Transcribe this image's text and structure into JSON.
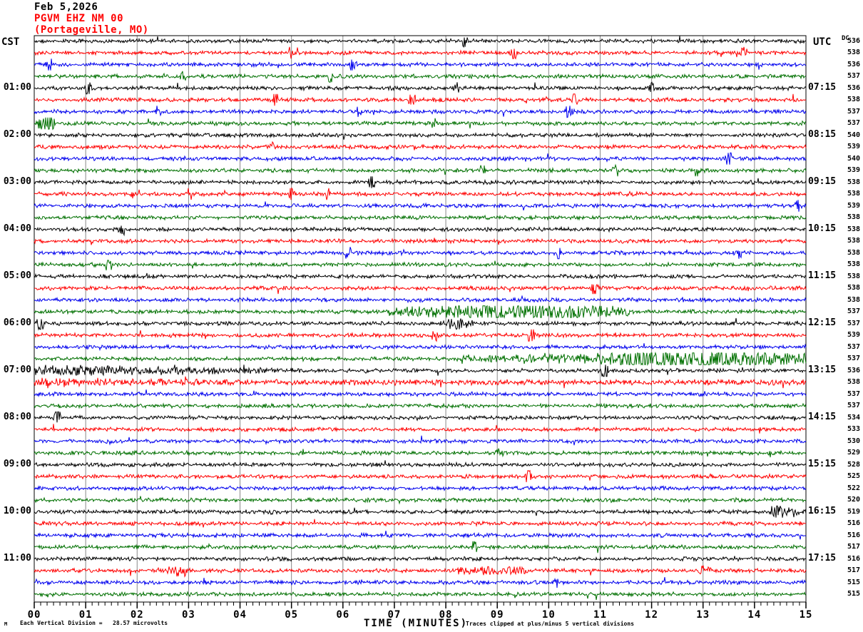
{
  "header": {
    "date": "Feb 5,2026",
    "station": "PGVM EHZ NM 00",
    "location": "(Portageville, MO)"
  },
  "corners": {
    "left_tz": "CST",
    "right_tz": "UTC",
    "dc_header": "DC"
  },
  "footer": {
    "mark": "M",
    "scale_note": "Each Vertical Division =   28.57 microvolts",
    "clip_note": "Traces clipped at plus/minus 5 vertical divisions"
  },
  "colors": {
    "trace_cycle": [
      "#000000",
      "#ff0000",
      "#0000ee",
      "#007000"
    ],
    "grid": "#888888",
    "frame": "#000000",
    "header_accent": "#ff0000"
  },
  "chart_data": {
    "type": "line",
    "subtype": "helicorder-seismogram",
    "title": "PGVM EHZ NM 00 (Portageville, MO) Feb 5,2026",
    "station": "PGVM EHZ NM 00",
    "location": "Portageville, MO",
    "date": "Feb 5,2026",
    "x_label": "TIME (MINUTES)",
    "x_range_minutes": [
      0,
      15
    ],
    "num_traces": 48,
    "trace_duration_minutes": 15,
    "first_trace_start_cst": "00:00",
    "left_timezone": "CST",
    "right_timezone": "UTC",
    "scale": "Each Vertical Division = 28.57 microvolts",
    "clipping": "Traces clipped at plus/minus 5 vertical divisions",
    "x_tick_labels": [
      "00",
      "01",
      "02",
      "03",
      "04",
      "05",
      "06",
      "07",
      "08",
      "09",
      "10",
      "11",
      "12",
      "13",
      "14",
      "15"
    ],
    "left_time_labels_cst": [
      {
        "row": 4,
        "text": "01:00"
      },
      {
        "row": 8,
        "text": "02:00"
      },
      {
        "row": 12,
        "text": "03:00"
      },
      {
        "row": 16,
        "text": "04:00"
      },
      {
        "row": 20,
        "text": "05:00"
      },
      {
        "row": 24,
        "text": "06:00"
      },
      {
        "row": 28,
        "text": "07:00"
      },
      {
        "row": 32,
        "text": "08:00"
      },
      {
        "row": 36,
        "text": "09:00"
      },
      {
        "row": 40,
        "text": "10:00"
      },
      {
        "row": 44,
        "text": "11:00"
      }
    ],
    "right_time_labels_utc": [
      {
        "row": 4,
        "text": "07:15"
      },
      {
        "row": 8,
        "text": "08:15"
      },
      {
        "row": 12,
        "text": "09:15"
      },
      {
        "row": 16,
        "text": "10:15"
      },
      {
        "row": 20,
        "text": "11:15"
      },
      {
        "row": 24,
        "text": "12:15"
      },
      {
        "row": 28,
        "text": "13:15"
      },
      {
        "row": 32,
        "text": "14:15"
      },
      {
        "row": 36,
        "text": "15:15"
      },
      {
        "row": 40,
        "text": "16:15"
      },
      {
        "row": 44,
        "text": "17:15"
      }
    ],
    "dc_offsets": [
      536,
      538,
      536,
      537,
      536,
      538,
      537,
      537,
      540,
      539,
      540,
      539,
      538,
      538,
      539,
      538,
      538,
      538,
      538,
      538,
      538,
      538,
      538,
      537,
      537,
      539,
      537,
      537,
      536,
      538,
      537,
      537,
      534,
      533,
      530,
      529,
      528,
      525,
      522,
      520,
      519,
      516,
      516,
      517,
      516,
      517,
      515,
      515
    ],
    "events": [
      {
        "row": 0,
        "kind": "spike",
        "t0": 8.35,
        "amp": 5
      },
      {
        "row": 1,
        "kind": "spike",
        "t0": 5.0,
        "amp": 4
      },
      {
        "row": 1,
        "kind": "spike",
        "t0": 9.3,
        "amp": 4.5
      },
      {
        "row": 1,
        "kind": "spike",
        "t0": 13.8,
        "amp": 4
      },
      {
        "row": 2,
        "kind": "spike",
        "t0": 0.3,
        "amp": 5
      },
      {
        "row": 2,
        "kind": "spike",
        "t0": 6.2,
        "amp": 3.5
      },
      {
        "row": 3,
        "kind": "spike",
        "t0": 2.9,
        "amp": 3
      },
      {
        "row": 3,
        "kind": "spike",
        "t0": 5.75,
        "amp": 4.5
      },
      {
        "row": 4,
        "kind": "spike",
        "t0": 1.05,
        "amp": 4
      },
      {
        "row": 4,
        "kind": "spike",
        "t0": 8.2,
        "amp": 4.5
      },
      {
        "row": 4,
        "kind": "spike",
        "t0": 12.0,
        "amp": 4
      },
      {
        "row": 5,
        "kind": "spike",
        "t0": 4.7,
        "amp": 4
      },
      {
        "row": 5,
        "kind": "spike",
        "t0": 7.35,
        "amp": 5
      },
      {
        "row": 5,
        "kind": "spike",
        "t0": 10.5,
        "amp": 4
      },
      {
        "row": 6,
        "kind": "spike",
        "t0": 2.4,
        "amp": 4
      },
      {
        "row": 6,
        "kind": "spike",
        "t0": 6.3,
        "amp": 3.5
      },
      {
        "row": 6,
        "kind": "spike",
        "t0": 10.4,
        "amp": 4.5
      },
      {
        "row": 7,
        "kind": "burst",
        "t0": 0.08,
        "t1": 0.4,
        "amp": 9
      },
      {
        "row": 7,
        "kind": "spike",
        "t0": 7.8,
        "amp": 4.5
      },
      {
        "row": 9,
        "kind": "spike",
        "t0": 4.6,
        "amp": 3.5
      },
      {
        "row": 10,
        "kind": "spike",
        "t0": 13.5,
        "amp": 4.5
      },
      {
        "row": 11,
        "kind": "spike",
        "t0": 8.7,
        "amp": 4
      },
      {
        "row": 11,
        "kind": "spike",
        "t0": 11.3,
        "amp": 3.5
      },
      {
        "row": 11,
        "kind": "spike",
        "t0": 12.9,
        "amp": 4
      },
      {
        "row": 12,
        "kind": "spike",
        "t0": 6.55,
        "amp": 6
      },
      {
        "row": 13,
        "kind": "spike",
        "t0": 3.0,
        "amp": 4
      },
      {
        "row": 13,
        "kind": "spike",
        "t0": 5.0,
        "amp": 4.5
      },
      {
        "row": 13,
        "kind": "spike",
        "t0": 5.7,
        "amp": 4
      },
      {
        "row": 14,
        "kind": "spike",
        "t0": 14.85,
        "amp": 5
      },
      {
        "row": 16,
        "kind": "spike",
        "t0": 1.7,
        "amp": 5
      },
      {
        "row": 18,
        "kind": "spike",
        "t0": 6.1,
        "amp": 4
      },
      {
        "row": 18,
        "kind": "spike",
        "t0": 10.2,
        "amp": 4
      },
      {
        "row": 18,
        "kind": "spike",
        "t0": 13.7,
        "amp": 4.5
      },
      {
        "row": 19,
        "kind": "spike",
        "t0": 1.45,
        "amp": 4.5
      },
      {
        "row": 21,
        "kind": "spike",
        "t0": 10.9,
        "amp": 4.5
      },
      {
        "row": 23,
        "kind": "burst",
        "t0": 6.9,
        "t1": 11.6,
        "amp": 5.5
      },
      {
        "row": 24,
        "kind": "spike",
        "t0": 0.12,
        "amp": 6
      },
      {
        "row": 24,
        "kind": "burst",
        "t0": 7.9,
        "t1": 8.6,
        "amp": 3.5
      },
      {
        "row": 25,
        "kind": "spike",
        "t0": 7.8,
        "amp": 3
      },
      {
        "row": 25,
        "kind": "spike",
        "t0": 9.66,
        "amp": 9
      },
      {
        "row": 27,
        "kind": "level",
        "t0": 8.3,
        "t1": 11.0,
        "amp": 2.3
      },
      {
        "row": 27,
        "kind": "burst",
        "t0": 10.9,
        "t1": 15.01,
        "amp": 8
      },
      {
        "row": 28,
        "kind": "fade",
        "t0": 0,
        "t1": 5.6,
        "amp": 3.2
      },
      {
        "row": 28,
        "kind": "spike",
        "t0": 11.1,
        "amp": 9
      },
      {
        "row": 29,
        "kind": "level",
        "t0": 0,
        "t1": 15.01,
        "amp": 1.35
      },
      {
        "row": 29,
        "kind": "fade",
        "t0": 0,
        "t1": 6.0,
        "amp": 2.4
      },
      {
        "row": 32,
        "kind": "spike",
        "t0": 0.45,
        "amp": 4.5
      },
      {
        "row": 35,
        "kind": "spike",
        "t0": 9.0,
        "amp": 3
      },
      {
        "row": 37,
        "kind": "spike",
        "t0": 9.6,
        "amp": 5
      },
      {
        "row": 40,
        "kind": "burst",
        "t0": 14.25,
        "t1": 14.9,
        "amp": 4.5
      },
      {
        "row": 43,
        "kind": "spike",
        "t0": 8.55,
        "amp": 6
      },
      {
        "row": 45,
        "kind": "burst",
        "t0": 2.55,
        "t1": 3.05,
        "amp": 4
      },
      {
        "row": 45,
        "kind": "level",
        "t0": 8.2,
        "t1": 9.6,
        "amp": 2.2
      },
      {
        "row": 45,
        "kind": "burst",
        "t0": 12.8,
        "t1": 13.2,
        "amp": 3
      },
      {
        "row": 46,
        "kind": "spike",
        "t0": 10.15,
        "amp": 3.5
      }
    ]
  }
}
